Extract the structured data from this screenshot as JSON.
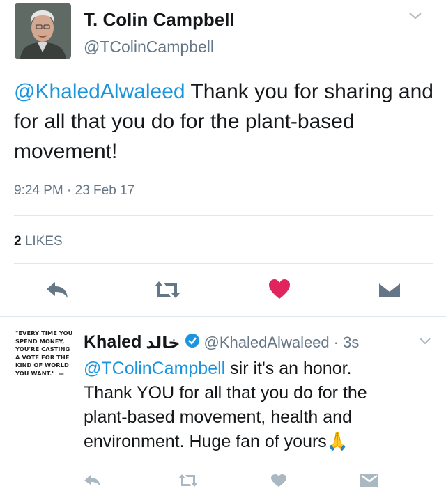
{
  "tweet": {
    "author_name": "T. Colin Campbell",
    "author_handle": "@TColinCampbell",
    "text_mention": "@KhaledAlwaleed",
    "text_rest": " Thank you for sharing and for all that you do for the plant-based movement!",
    "time": "9:24 PM · 23 Feb 17",
    "likes_count": "2",
    "likes_label": "LIKES",
    "like_color": "#e0245e",
    "accent_color": "#1b95e0"
  },
  "reply": {
    "author_name": "Khaled",
    "author_arabic": "خالد",
    "author_handle": "@KhaledAlwaleed",
    "time_ago": "· 3s",
    "text_mention": "@TColinCampbell",
    "line1_rest": " sir it's an honor.",
    "line2": "Thank YOU for all that you do for the",
    "line3": "plant-based movement, health and",
    "line4": "environment. Huge fan of yours",
    "emoji": "🙏",
    "quote_lines": [
      "\"EVERY TIME YOU",
      "SPEND MONEY,",
      "YOU'RE CASTING",
      "A VOTE FOR THE",
      "KIND OF WORLD",
      "YOU WANT.\""
    ],
    "quote_dash": "—"
  }
}
